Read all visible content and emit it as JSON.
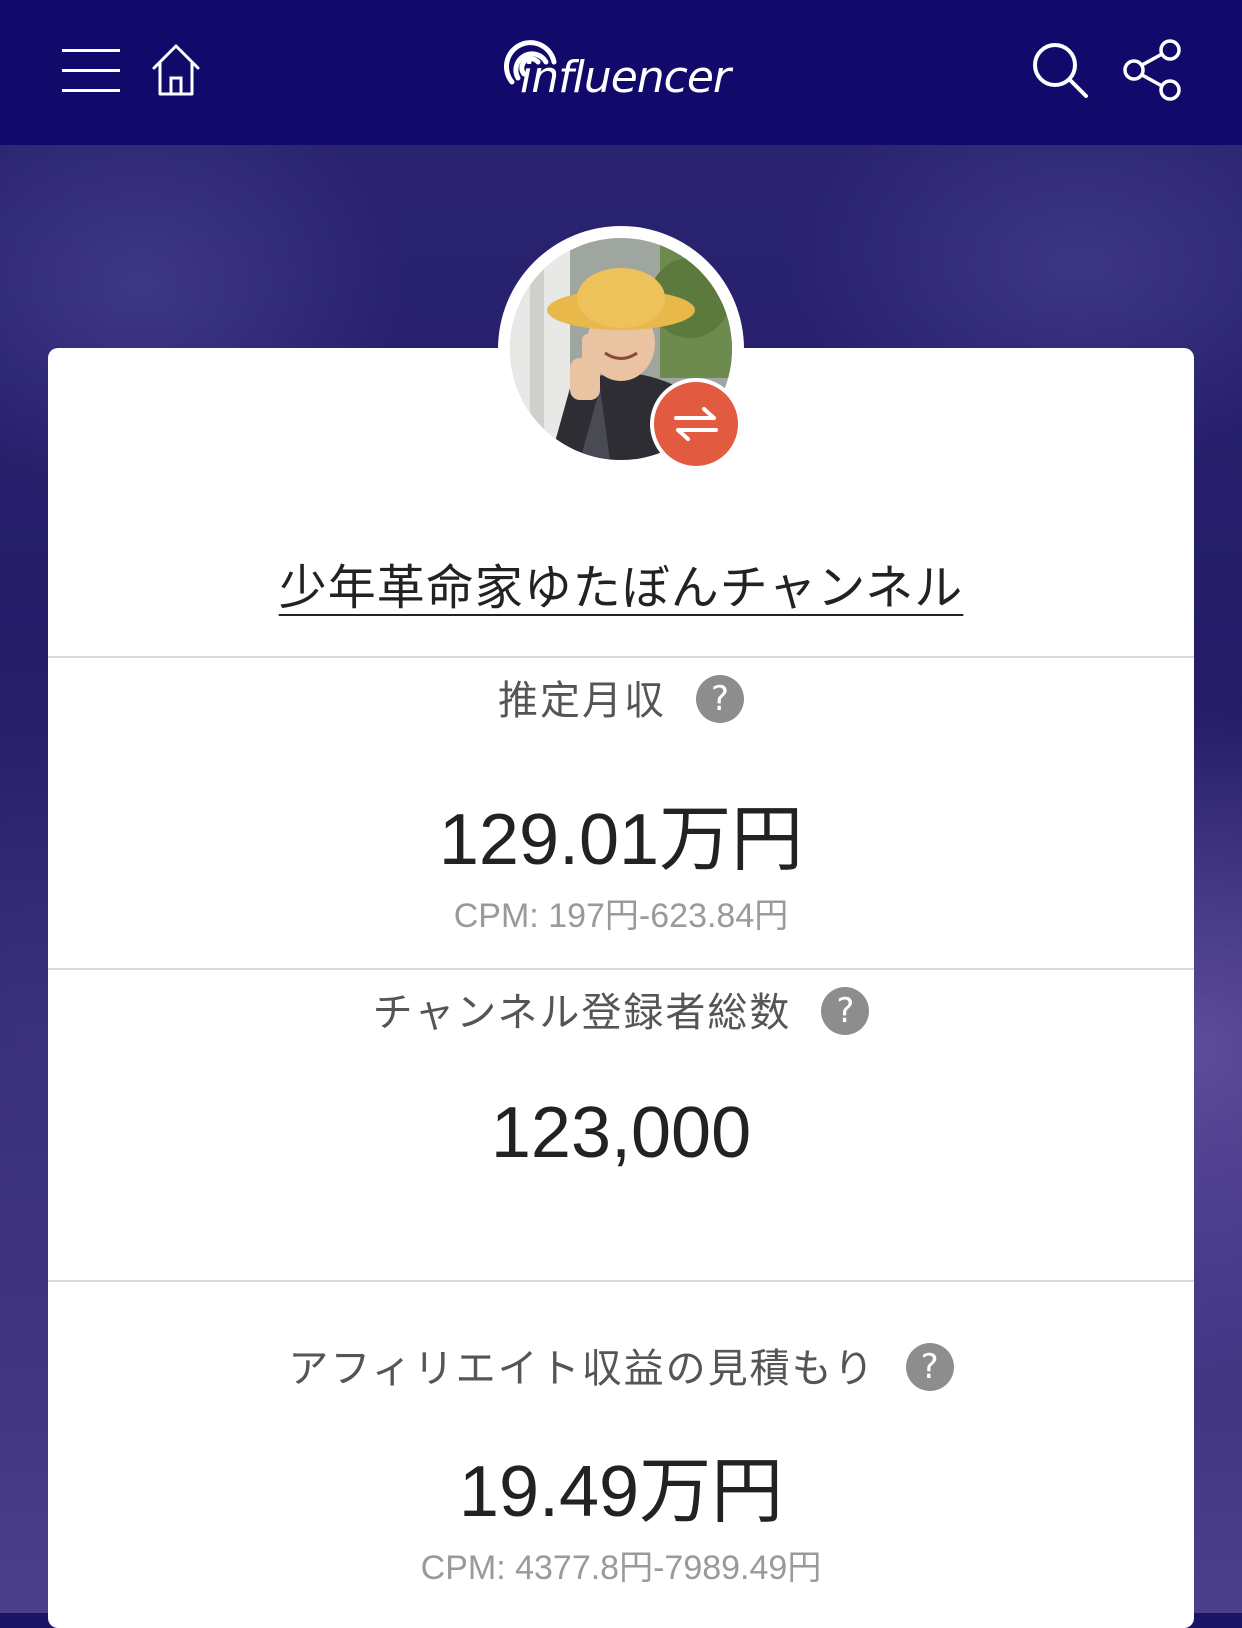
{
  "header": {
    "logo_text": "influencer",
    "icons": [
      "menu-icon",
      "home-icon",
      "search-icon",
      "share-icon"
    ]
  },
  "profile": {
    "channel_name": "少年革命家ゆたぼんチャンネル",
    "badge_icon": "swap-arrows-icon",
    "badge_color": "#e25a3f"
  },
  "stats": [
    {
      "label": "推定月収",
      "help": "?",
      "value": "129.01万円",
      "cpm": "CPM: 197円-623.84円"
    },
    {
      "label": "チャンネル登録者総数",
      "help": "?",
      "value": "123,000",
      "cpm": ""
    },
    {
      "label": "アフィリエイト収益の見積もり",
      "help": "?",
      "value": "19.49万円",
      "cpm": "CPM: 4377.8円-7989.49円"
    }
  ],
  "colors": {
    "nav_bg": "#120a6b",
    "accent": "#e25a3f",
    "help_icon": "#8d8d8d"
  }
}
